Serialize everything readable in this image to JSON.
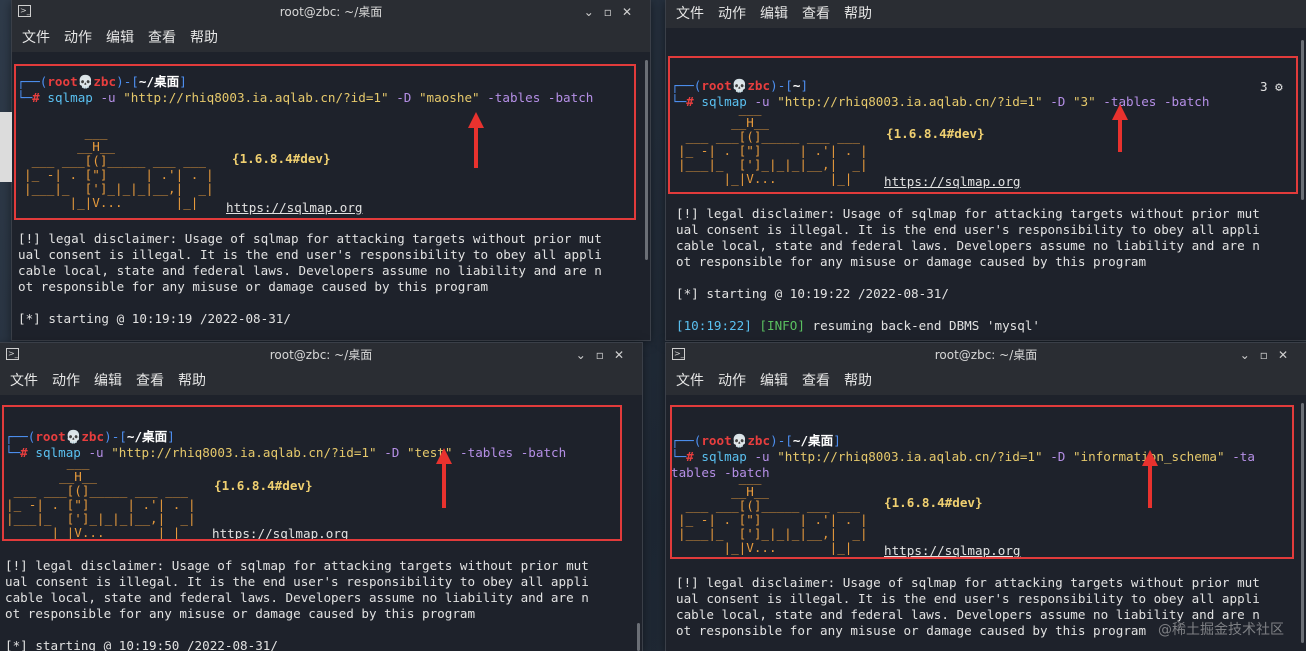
{
  "windows": {
    "tl": {
      "title": "root@zbc: ~/桌面",
      "menu": [
        "文件",
        "动作",
        "编辑",
        "查看",
        "帮助"
      ],
      "prompt_user": "root💀zbc",
      "prompt_path": "~/桌面",
      "cmd": "sqlmap",
      "url": "\"http://rhiq8003.ia.aqlab.cn/?id=1\"",
      "db": "\"maoshe\"",
      "version": "{1.6.8.4#dev}",
      "site": "https://sqlmap.org",
      "legal": [
        "[!] legal disclaimer: Usage of sqlmap for attacking targets without prior mut",
        "ual consent is illegal. It is the end user's responsibility to obey all appli",
        "cable local, state and federal laws. Developers assume no liability and are n",
        "ot responsible for any misuse or damage caused by this program"
      ],
      "starting": "[*] starting @ 10:19:19 /2022-08-31/"
    },
    "tr": {
      "menu": [
        "文件",
        "动作",
        "编辑",
        "查看",
        "帮助"
      ],
      "prompt_user": "root💀zbc",
      "prompt_path": "~",
      "cmd": "sqlmap",
      "url": "\"http://rhiq8003.ia.aqlab.cn/?id=1\"",
      "db": "\"3\"",
      "badge": "3 ⚙",
      "version": "{1.6.8.4#dev}",
      "site": "https://sqlmap.org",
      "legal": [
        "[!] legal disclaimer: Usage of sqlmap for attacking targets without prior mut",
        "ual consent is illegal. It is the end user's responsibility to obey all appli",
        "cable local, state and federal laws. Developers assume no liability and are n",
        "ot responsible for any misuse or damage caused by this program"
      ],
      "starting": "[*] starting @ 10:19:22 /2022-08-31/",
      "log_time": "[10:19:22]",
      "log_level": "[INFO]",
      "log_msg": "resuming back-end DBMS 'mysql'"
    },
    "bl": {
      "title": "root@zbc: ~/桌面",
      "menu": [
        "文件",
        "动作",
        "编辑",
        "查看",
        "帮助"
      ],
      "prompt_user": "root💀zbc",
      "prompt_path": "~/桌面",
      "cmd": "sqlmap",
      "url": "\"http://rhiq8003.ia.aqlab.cn/?id=1\"",
      "db": "\"test\"",
      "version": "{1.6.8.4#dev}",
      "site": "https://sqlmap.org",
      "legal": [
        "[!] legal disclaimer: Usage of sqlmap for attacking targets without prior mut",
        "ual consent is illegal. It is the end user's responsibility to obey all appli",
        "cable local, state and federal laws. Developers assume no liability and are n",
        "ot responsible for any misuse or damage caused by this program"
      ],
      "starting": "[*] starting @ 10:19:50 /2022-08-31/"
    },
    "br": {
      "title": "root@zbc: ~/桌面",
      "menu": [
        "文件",
        "动作",
        "编辑",
        "查看",
        "帮助"
      ],
      "prompt_user": "root💀zbc",
      "prompt_path": "~/桌面",
      "cmd": "sqlmap",
      "url": "\"http://rhiq8003.ia.aqlab.cn/?id=1\"",
      "db": "\"information_schema\"",
      "opt_wrap": "tables -batch",
      "version": "{1.6.8.4#dev}",
      "site": "https://sqlmap.org",
      "legal": [
        "[!] legal disclaimer: Usage of sqlmap for attacking targets without prior mut",
        "ual consent is illegal. It is the end user's responsibility to obey all appli",
        "cable local, state and federal laws. Developers assume no liability and are n",
        "ot responsible for any misuse or damage caused by this program"
      ]
    }
  },
  "common": {
    "flag_u": "-u",
    "flag_d": "-D",
    "flags_rest": "-tables -batch",
    "flag_rest_partial": "-ta"
  },
  "banner": {
    "l1": "        ___",
    "l2": "       __H__",
    "l3": " ___ ___[(]_____ ___ ___",
    "l4": "|_ -| . [\"]     | .'| . |",
    "l5": "|___|_  [']_|_|_|__,|  _|",
    "l6": "      |_|V...       |_|"
  },
  "watermark": "@稀土掘金技术社区"
}
